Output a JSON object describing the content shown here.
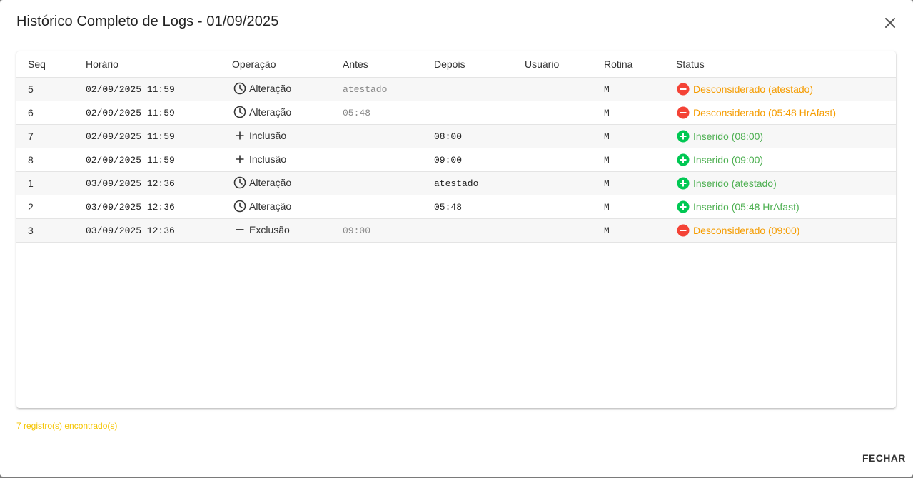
{
  "dialog": {
    "title": "Histórico Completo de Logs - 01/09/2025",
    "close_icon": "close-icon",
    "footer_count": "7 registro(s) encontrado(s)",
    "close_label": "FECHAR"
  },
  "table": {
    "headers": {
      "seq": "Seq",
      "horario": "Horário",
      "operacao": "Operação",
      "antes": "Antes",
      "depois": "Depois",
      "usuario": "Usuário",
      "rotina": "Rotina",
      "status": "Status"
    },
    "rows": [
      {
        "seq": "5",
        "horario": "02/09/2025 11:59",
        "operacao": "Alteração",
        "op_icon": "clock-icon",
        "antes": "atestado",
        "depois": "",
        "usuario": "",
        "rotina": "M",
        "status": "Desconsiderado (atestado)",
        "status_type": "removed"
      },
      {
        "seq": "6",
        "horario": "02/09/2025 11:59",
        "operacao": "Alteração",
        "op_icon": "clock-icon",
        "antes": "05:48",
        "depois": "",
        "usuario": "",
        "rotina": "M",
        "status": "Desconsiderado (05:48 HrAfast)",
        "status_type": "removed"
      },
      {
        "seq": "7",
        "horario": "02/09/2025 11:59",
        "operacao": "Inclusão",
        "op_icon": "plus-icon",
        "antes": "",
        "depois": "08:00",
        "usuario": "",
        "rotina": "M",
        "status": "Inserido (08:00)",
        "status_type": "inserted"
      },
      {
        "seq": "8",
        "horario": "02/09/2025 11:59",
        "operacao": "Inclusão",
        "op_icon": "plus-icon",
        "antes": "",
        "depois": "09:00",
        "usuario": "",
        "rotina": "M",
        "status": "Inserido (09:00)",
        "status_type": "inserted"
      },
      {
        "seq": "1",
        "horario": "03/09/2025 12:36",
        "operacao": "Alteração",
        "op_icon": "clock-icon",
        "antes": "",
        "depois": "atestado",
        "usuario": "",
        "rotina": "M",
        "status": "Inserido (atestado)",
        "status_type": "inserted"
      },
      {
        "seq": "2",
        "horario": "03/09/2025 12:36",
        "operacao": "Alteração",
        "op_icon": "clock-icon",
        "antes": "",
        "depois": "05:48",
        "usuario": "",
        "rotina": "M",
        "status": "Inserido (05:48 HrAfast)",
        "status_type": "inserted"
      },
      {
        "seq": "3",
        "horario": "03/09/2025 12:36",
        "operacao": "Exclusão",
        "op_icon": "minus-icon",
        "antes": "09:00",
        "depois": "",
        "usuario": "",
        "rotina": "M",
        "status": "Desconsiderado (09:00)",
        "status_type": "removed"
      }
    ]
  },
  "colors": {
    "removed_text": "#f59c00",
    "removed_icon": "#f44336",
    "inserted_text": "#4caf50",
    "inserted_icon": "#00c853",
    "footer_text": "#f5c400"
  }
}
